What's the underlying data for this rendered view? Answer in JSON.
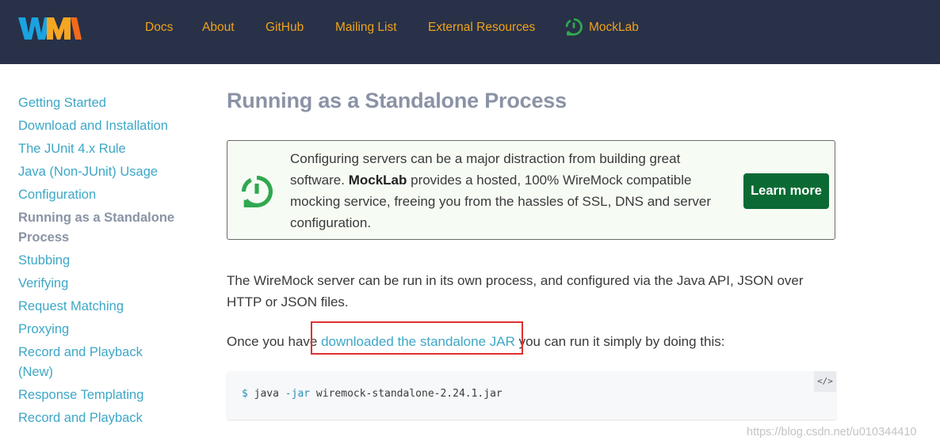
{
  "header": {
    "nav": [
      {
        "label": "Docs"
      },
      {
        "label": "About"
      },
      {
        "label": "GitHub"
      },
      {
        "label": "Mailing List"
      },
      {
        "label": "External Resources"
      },
      {
        "label": "MockLab",
        "icon": "mocklab-icon"
      }
    ],
    "colors": {
      "background": "#283147",
      "link": "#f0a31b"
    }
  },
  "sidebar": {
    "items": [
      {
        "label": "Getting Started"
      },
      {
        "label": "Download and Installation"
      },
      {
        "label": "The JUnit 4.x Rule"
      },
      {
        "label": "Java (Non-JUnit) Usage"
      },
      {
        "label": "Configuration"
      },
      {
        "label": "Running as a Standalone Process",
        "active": true
      },
      {
        "label": "Stubbing"
      },
      {
        "label": "Verifying"
      },
      {
        "label": "Request Matching"
      },
      {
        "label": "Proxying"
      },
      {
        "label": "Record and Playback (New)"
      },
      {
        "label": "Response Templating"
      },
      {
        "label": "Record and Playback"
      }
    ]
  },
  "main": {
    "title": "Running as a Standalone Process",
    "promo": {
      "text_before": "Configuring servers can be a major distraction from building great software. ",
      "brand": "MockLab",
      "text_after": " provides a hosted, 100% WireMock compatible mocking service, freeing you from the hassles of SSL, DNS and server configuration.",
      "button_label": "Learn more",
      "button_color": "#0b6a33"
    },
    "paragraph1": "The WireMock server can be run in its own process, and configured via the Java API, JSON over HTTP or JSON files.",
    "paragraph2": {
      "before": "Once you have ",
      "link": "downloaded the standalone JAR",
      "after": " you can run it simply by doing this:"
    },
    "code": {
      "prompt": "$",
      "command": " java ",
      "flag": "-jar",
      "argument": " wiremock-standalone-2.24.1.jar",
      "toggle": "</>"
    }
  },
  "watermark": "https://blog.csdn.net/u010344410"
}
